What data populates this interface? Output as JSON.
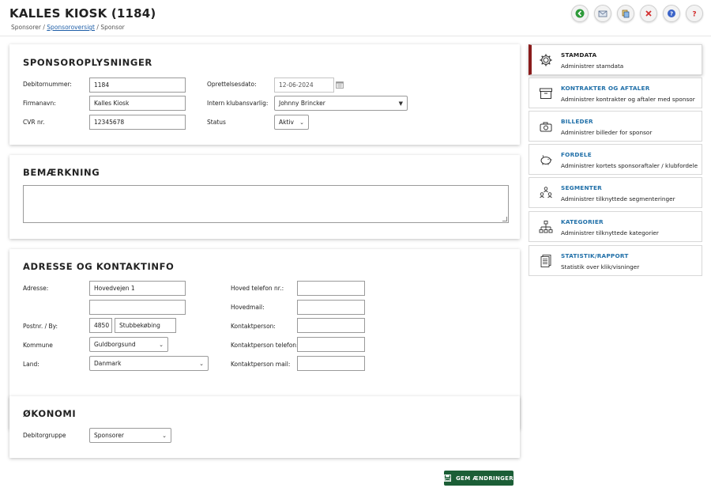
{
  "header": {
    "title": "KALLES KIOSK (1184)",
    "breadcrumb": {
      "item1": "Sponsorer",
      "sep": "/",
      "item2": "Sponsoroversigt",
      "item3": "Sponsor"
    }
  },
  "toolbar": {
    "buttons": [
      "back-icon",
      "mail-icon",
      "copy-icon",
      "delete-icon",
      "help-icon",
      "question-icon"
    ]
  },
  "sponsor_info": {
    "title": "SPONSOROPLYSNINGER",
    "debitor_label": "Debitornummer:",
    "debitor_value": "1184",
    "firma_label": "Firmanavn:",
    "firma_value": "Kalles Kiosk",
    "cvr_label": "CVR nr.",
    "cvr_value": "12345678",
    "oprettelse_label": "Oprettelsesdato:",
    "oprettelse_value": "12-06-2024",
    "klub_label": "Intern klubansvarlig:",
    "klub_value": "Johnny Brincker",
    "status_label": "Status",
    "status_value": "Aktiv"
  },
  "remark": {
    "title": "BEMÆRKNING",
    "value": ""
  },
  "address": {
    "title": "ADRESSE OG KONTAKTINFO",
    "adresse_label": "Adresse:",
    "adresse_value": "Hovedvejen 1",
    "adresse2_value": "",
    "postnr_label": "Postnr. / By:",
    "postnr_value": "4850",
    "by_value": "Stubbekøbing",
    "kommune_label": "Kommune",
    "kommune_value": "Guldborgsund",
    "land_label": "Land:",
    "land_value": "Danmark",
    "telefon_label": "Hoved telefon nr.:",
    "telefon_value": "",
    "mail_label": "Hovedmail:",
    "mail_value": "",
    "kontakt_label": "Kontaktperson:",
    "kontakt_value": "",
    "kontakt_tel_label": "Kontaktperson telefon:",
    "kontakt_tel_value": "",
    "kontakt_mail_label": "Kontaktperson mail:",
    "kontakt_mail_value": ""
  },
  "economy": {
    "title": "ØKONOMI",
    "debitorgruppe_label": "Debitorgruppe",
    "debitorgruppe_value": "Sponsorer"
  },
  "save_label": "GEM ÆNDRINGER",
  "sidebar": {
    "items": [
      {
        "title": "STAMDATA",
        "desc": "Administrer stamdata",
        "icon": "gear-icon",
        "active": true
      },
      {
        "title": "KONTRAKTER OG AFTALER",
        "desc": "Administrer kontrakter og aftaler med sponsor",
        "icon": "archive-icon"
      },
      {
        "title": "BILLEDER",
        "desc": "Administrer billeder for sponsor",
        "icon": "camera-icon"
      },
      {
        "title": "FORDELE",
        "desc": "Administrer kortets sponsoraftaler / klubfordele",
        "icon": "piggy-bank-icon"
      },
      {
        "title": "SEGMENTER",
        "desc": "Administrer tilknyttede segmenteringer",
        "icon": "people-group-icon"
      },
      {
        "title": "KATEGORIER",
        "desc": "Administrer tilknyttede kategorier",
        "icon": "hierarchy-icon"
      },
      {
        "title": "STATISTIK/RAPPORT",
        "desc": "Statistik over klik/visninger",
        "icon": "report-icon"
      }
    ]
  },
  "colors": {
    "accent_green": "#1b5e36",
    "active_marker": "#8a1c1c",
    "link_blue": "#1f6fa8"
  }
}
